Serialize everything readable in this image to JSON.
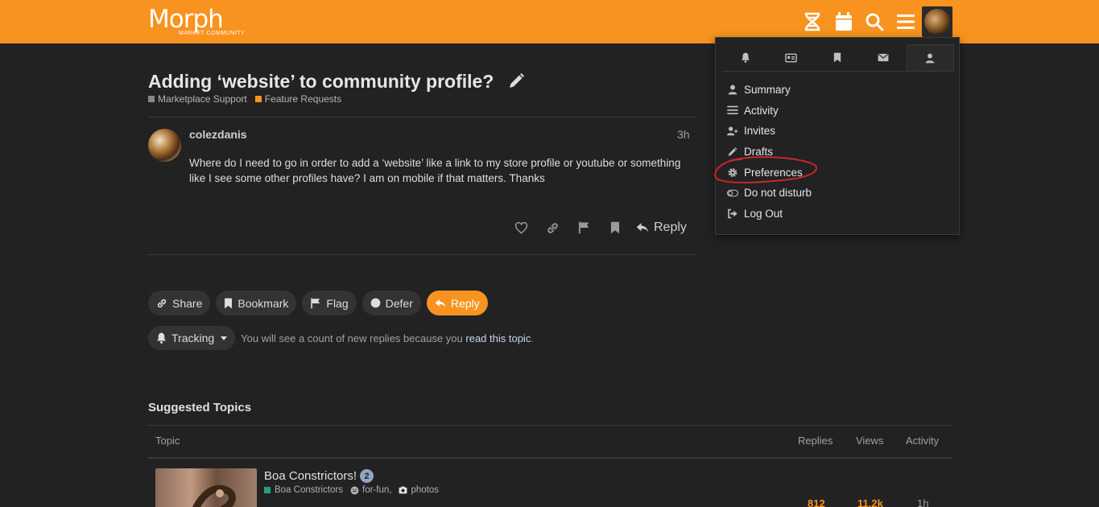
{
  "header": {
    "logo_text": "Morph",
    "logo_subtext": "MARKET COMMUNITY",
    "bg_color": "#f7931e",
    "icons": [
      "dna-icon",
      "calendar-icon",
      "search-icon",
      "hamburger-icon",
      "avatar"
    ]
  },
  "topic": {
    "title": "Adding ‘website’ to community profile?",
    "categories": [
      {
        "name": "Marketplace Support",
        "color": "#888888"
      },
      {
        "name": "Feature Requests",
        "color": "#f7931e"
      }
    ]
  },
  "post": {
    "author": "colezdanis",
    "time": "3h",
    "body": "Where do I need to go in order to add a ‘website’ like a link to my store profile or youtube or something like I see some other profiles have? I am on mobile if that matters. Thanks",
    "reply_label": "Reply"
  },
  "buttons": {
    "share": "Share",
    "bookmark": "Bookmark",
    "flag": "Flag",
    "defer": "Defer",
    "reply": "Reply"
  },
  "tracking": {
    "label": "Tracking",
    "text_before": "You will see a count of new replies because you",
    "link": "read this topic",
    "text_after": "."
  },
  "suggested": {
    "title": "Suggested Topics",
    "columns": {
      "topic": "Topic",
      "replies": "Replies",
      "views": "Views",
      "activity": "Activity"
    },
    "rows": [
      {
        "title": "Boa Constrictors!",
        "badge": "2",
        "category": "Boa Constrictors",
        "tags": [
          "for-fun,",
          "photos"
        ],
        "replies": "812",
        "views": "11.2k",
        "activity": "1h"
      }
    ]
  },
  "user_menu": {
    "tabs": [
      "bell-icon",
      "id-card-icon",
      "bookmark-icon",
      "envelope-icon",
      "user-icon"
    ],
    "items": [
      {
        "label": "Summary",
        "icon": "user-icon"
      },
      {
        "label": "Activity",
        "icon": "list-icon"
      },
      {
        "label": "Invites",
        "icon": "user-plus-icon"
      },
      {
        "label": "Drafts",
        "icon": "pencil-icon"
      },
      {
        "label": "Preferences",
        "icon": "gear-icon"
      },
      {
        "label": "Do not disturb",
        "icon": "toggle-icon"
      },
      {
        "label": "Log Out",
        "icon": "sign-out-icon"
      }
    ],
    "annotation_color": "#c62828"
  }
}
